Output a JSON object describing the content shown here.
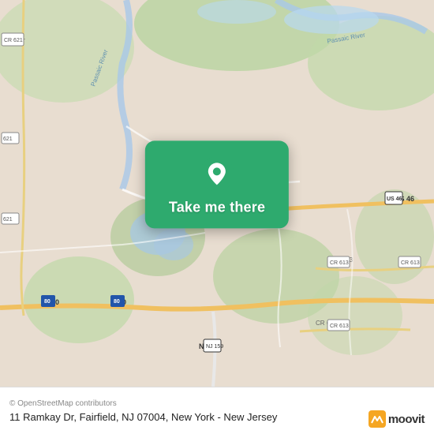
{
  "map": {
    "background_color": "#e8e0d8",
    "overlay_color": "#2eaa6e",
    "button_label": "Take me there",
    "pin_icon": "location-pin"
  },
  "bottom_bar": {
    "copyright": "© OpenStreetMap contributors",
    "address": "11 Ramkay Dr, Fairfield, NJ 07004, New York - New Jersey"
  },
  "branding": {
    "name": "moovit"
  }
}
